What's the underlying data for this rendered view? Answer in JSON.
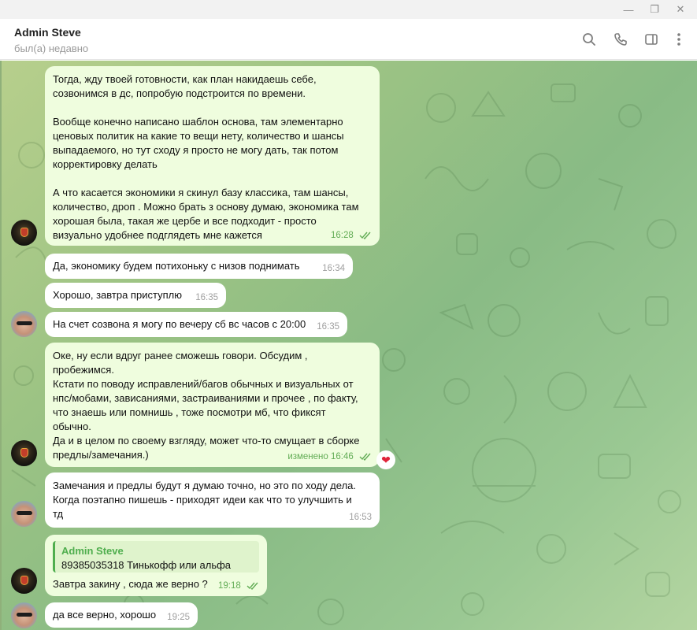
{
  "window": {
    "controls": [
      "—",
      "❐",
      "✕"
    ]
  },
  "header": {
    "name": "Admin Steve",
    "status": "был(а) недавно",
    "icons": [
      "search-icon",
      "phone-icon",
      "sidebar-toggle-icon",
      "more-vert-icon"
    ]
  },
  "colors": {
    "own_bubble": "#effdde",
    "incoming_bubble": "#ffffff",
    "own_meta": "#62ac55",
    "accent": "#4fae4e",
    "heart": "#e0243a"
  },
  "messages": [
    {
      "sender": "Admin Steve",
      "own": true,
      "text": "Тогда, жду твоей готовности, как план накидаешь себе,\nсозвонимся в дс, попробую подстроится по времени.\n\nВообще конечно написано шаблон основа, там элементарно\nценовых политик на какие то вещи нету, количество и шансы\nвыпадаемого, но тут сходу я просто не могу дать, так потом\nкорректировку делать\n\nА что касается экономики я скинул базу классика, там шансы,\nколичество, дроп . Можно брать з основу думаю, экономика там\nхорошая была, такая же цербе и все подходит - просто\nвизуально удобнее подглядеть мне кажется",
      "time": "16:28"
    },
    {
      "own": false,
      "text": "Да, экономику будем потихоньку с низов поднимать",
      "time": "16:34"
    },
    {
      "own": false,
      "text": "Хорошо, завтра приступлю",
      "time": "16:35"
    },
    {
      "own": false,
      "text": "На счет созвона я могу по вечеру сб вс часов с 20:00",
      "time": "16:35"
    },
    {
      "own": true,
      "text": "Оке, ну если вдруг ранее сможешь говори. Обсудим ,\nпробежимся.\nКстати по поводу исправлений/багов обычных и визуальных от\nнпс/мобами, зависаниями, застраиваниями и прочее , по факту,\nчто знаешь или помнишь , тоже посмотри мб, что фиксят\nобычно.\nДа и в целом по своему взгляду, может что-то смущает в сборке\nпредлы/замечания.)",
      "edited": "изменено",
      "time": "16:46",
      "reaction": "❤"
    },
    {
      "own": false,
      "text": "Замечания и предлы будут я думаю точно, но это по ходу дела.\nКогда поэтапно пишешь - приходят идеи как что то улучшить и\nтд",
      "time": "16:53"
    },
    {
      "own": true,
      "reply_name": "Admin Steve",
      "reply_text": "89385035318 Тинькофф или альфа",
      "text": "Завтра закину , сюда же верно ?",
      "time": "19:18"
    },
    {
      "own": false,
      "text": "да все верно, хорошо",
      "time": "19:25"
    }
  ]
}
